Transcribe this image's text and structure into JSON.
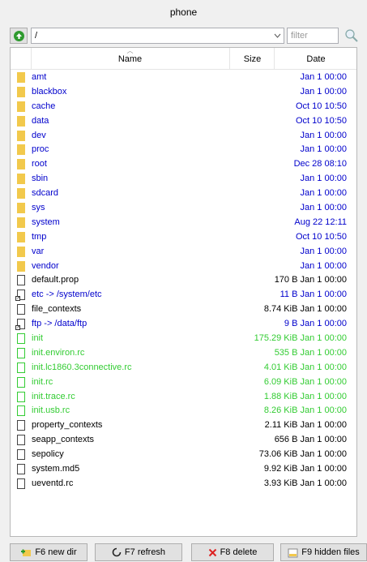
{
  "window": {
    "title": "phone"
  },
  "pathbar": {
    "path": "/",
    "filter_placeholder": "filter"
  },
  "columns": {
    "name": "Name",
    "size": "Size",
    "date": "Date"
  },
  "entries": [
    {
      "name": "amt",
      "size": "",
      "date": "Jan 1 00:00",
      "kind": "dir"
    },
    {
      "name": "blackbox",
      "size": "",
      "date": "Jan 1 00:00",
      "kind": "dir"
    },
    {
      "name": "cache",
      "size": "",
      "date": "Oct 10 10:50",
      "kind": "dir"
    },
    {
      "name": "data",
      "size": "",
      "date": "Oct 10 10:50",
      "kind": "dir"
    },
    {
      "name": "dev",
      "size": "",
      "date": "Jan 1 00:00",
      "kind": "dir"
    },
    {
      "name": "proc",
      "size": "",
      "date": "Jan 1 00:00",
      "kind": "dir"
    },
    {
      "name": "root",
      "size": "",
      "date": "Dec 28 08:10",
      "kind": "dir"
    },
    {
      "name": "sbin",
      "size": "",
      "date": "Jan 1 00:00",
      "kind": "dir"
    },
    {
      "name": "sdcard",
      "size": "",
      "date": "Jan 1 00:00",
      "kind": "dir"
    },
    {
      "name": "sys",
      "size": "",
      "date": "Jan 1 00:00",
      "kind": "dir"
    },
    {
      "name": "system",
      "size": "",
      "date": "Aug 22 12:11",
      "kind": "dir"
    },
    {
      "name": "tmp",
      "size": "",
      "date": "Oct 10 10:50",
      "kind": "dir"
    },
    {
      "name": "var",
      "size": "",
      "date": "Jan 1 00:00",
      "kind": "dir"
    },
    {
      "name": "vendor",
      "size": "",
      "date": "Jan 1 00:00",
      "kind": "dir"
    },
    {
      "name": "default.prop",
      "size": "170 B",
      "date": "Jan 1 00:00",
      "kind": "file"
    },
    {
      "name": "etc -> /system/etc",
      "size": "11 B",
      "date": "Jan 1 00:00",
      "kind": "link"
    },
    {
      "name": "file_contexts",
      "size": "8.74 KiB",
      "date": "Jan 1 00:00",
      "kind": "file"
    },
    {
      "name": "ftp -> /data/ftp",
      "size": "9 B",
      "date": "Jan 1 00:00",
      "kind": "link"
    },
    {
      "name": "init",
      "size": "175.29 KiB",
      "date": "Jan 1 00:00",
      "kind": "exec"
    },
    {
      "name": "init.environ.rc",
      "size": "535 B",
      "date": "Jan 1 00:00",
      "kind": "exec"
    },
    {
      "name": "init.lc1860.3connective.rc",
      "size": "4.01 KiB",
      "date": "Jan 1 00:00",
      "kind": "exec"
    },
    {
      "name": "init.rc",
      "size": "6.09 KiB",
      "date": "Jan 1 00:00",
      "kind": "exec"
    },
    {
      "name": "init.trace.rc",
      "size": "1.88 KiB",
      "date": "Jan 1 00:00",
      "kind": "exec"
    },
    {
      "name": "init.usb.rc",
      "size": "8.26 KiB",
      "date": "Jan 1 00:00",
      "kind": "exec"
    },
    {
      "name": "property_contexts",
      "size": "2.11 KiB",
      "date": "Jan 1 00:00",
      "kind": "file"
    },
    {
      "name": "seapp_contexts",
      "size": "656 B",
      "date": "Jan 1 00:00",
      "kind": "file"
    },
    {
      "name": "sepolicy",
      "size": "73.06 KiB",
      "date": "Jan 1 00:00",
      "kind": "file"
    },
    {
      "name": "system.md5",
      "size": "9.92 KiB",
      "date": "Jan 1 00:00",
      "kind": "file"
    },
    {
      "name": "ueventd.rc",
      "size": "3.93 KiB",
      "date": "Jan 1 00:00",
      "kind": "file"
    }
  ],
  "toolbar": {
    "new_dir": "F6 new dir",
    "refresh": "F7 refresh",
    "delete": "F8 delete",
    "hidden": "F9 hidden files"
  },
  "colors": {
    "dir": "#0000cc",
    "exec": "#33cc33",
    "file": "#000000",
    "folder": "#f2c94c"
  }
}
